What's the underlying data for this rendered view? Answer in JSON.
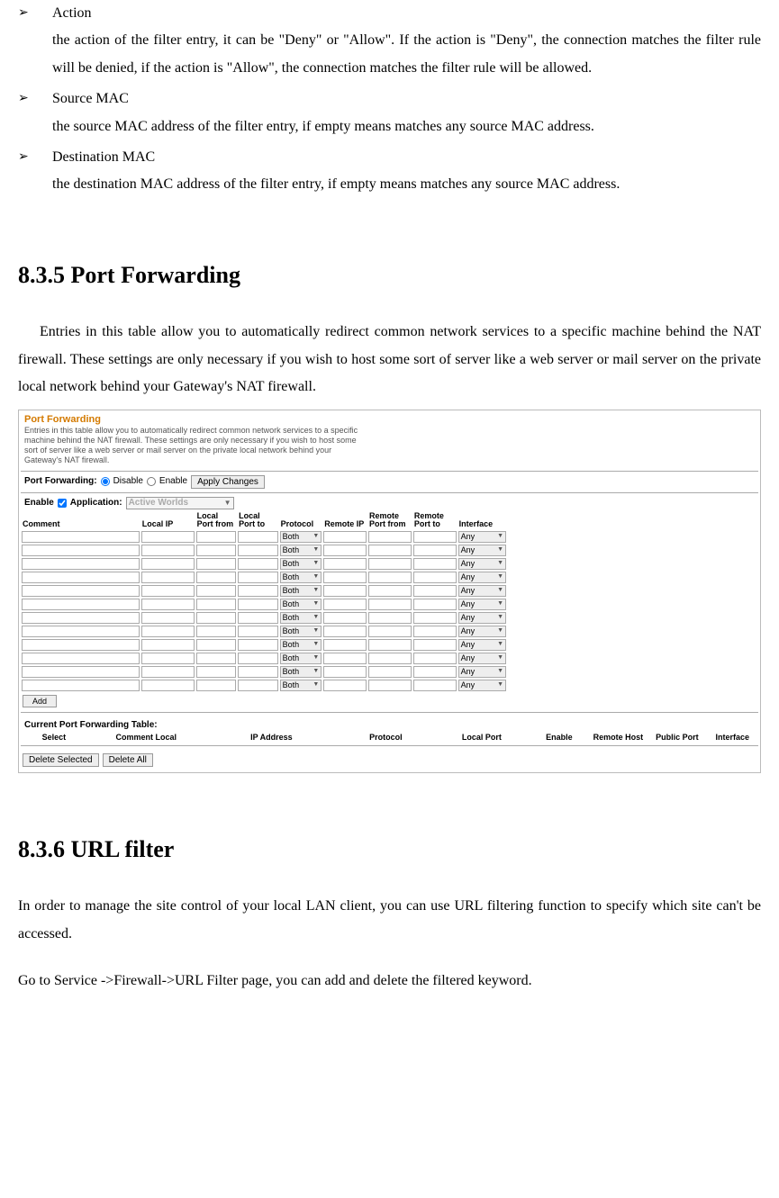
{
  "bullets": [
    {
      "term": "Action",
      "desc": "the action of the filter entry, it can be \"Deny\" or \"Allow\". If the action is \"Deny\", the connection matches the filter rule will be denied, if the action is \"Allow\", the connection matches the filter rule will be allowed."
    },
    {
      "term": "Source MAC",
      "desc": "the source MAC address of the filter entry, if empty means matches any source MAC address."
    },
    {
      "term": "Destination MAC",
      "desc": "the destination MAC address of the filter entry, if empty means matches any source MAC address."
    }
  ],
  "section835": {
    "heading": "8.3.5 Port Forwarding",
    "paragraph": "Entries in this table allow you to automatically redirect common network services to a specific machine behind the NAT firewall. These settings are only necessary if you wish to host some sort of server like a web server or mail server on the private local network behind your Gateway's NAT firewall."
  },
  "ui": {
    "title": "Port Forwarding",
    "intro": "Entries in this table allow you to automatically redirect common network services to a specific machine behind the NAT firewall. These settings are only necessary if you wish to host some sort of server like a web server or mail server on the private local network behind your Gateway's NAT firewall.",
    "toggle": {
      "label": "Port Forwarding:",
      "opt_disable": "Disable",
      "opt_enable": "Enable",
      "apply_btn": "Apply Changes"
    },
    "app": {
      "enable_label": "Enable",
      "app_label": "Application:",
      "select_value": "Active Worlds"
    },
    "headers": {
      "comment": "Comment",
      "local_ip": "Local IP",
      "local_port_from": "Local Port from",
      "local_port_to": "Local Port to",
      "protocol": "Protocol",
      "remote_ip": "Remote IP",
      "remote_port_from": "Remote Port from",
      "remote_port_to": "Remote Port to",
      "interface": "Interface"
    },
    "row_defaults": {
      "proto": "Both",
      "iface": "Any"
    },
    "row_count": 12,
    "add_btn": "Add",
    "current_label": "Current Port Forwarding Table:",
    "current_headers": {
      "select": "Select",
      "comment_local": "Comment Local",
      "ip": "IP Address",
      "protocol": "Protocol",
      "local_port": "Local Port",
      "enable": "Enable",
      "remote_host": "Remote Host",
      "public_port": "Public Port",
      "interface": "Interface"
    },
    "footer_btns": {
      "delete_selected": "Delete Selected",
      "delete_all": "Delete All"
    }
  },
  "section836": {
    "heading": "8.3.6 URL filter",
    "p1": "In order to manage the site control of your local LAN client, you can use URL filtering function to specify which site can't be accessed.",
    "p2": "Go to Service ->Firewall->URL Filter page, you can add and delete the filtered keyword."
  }
}
